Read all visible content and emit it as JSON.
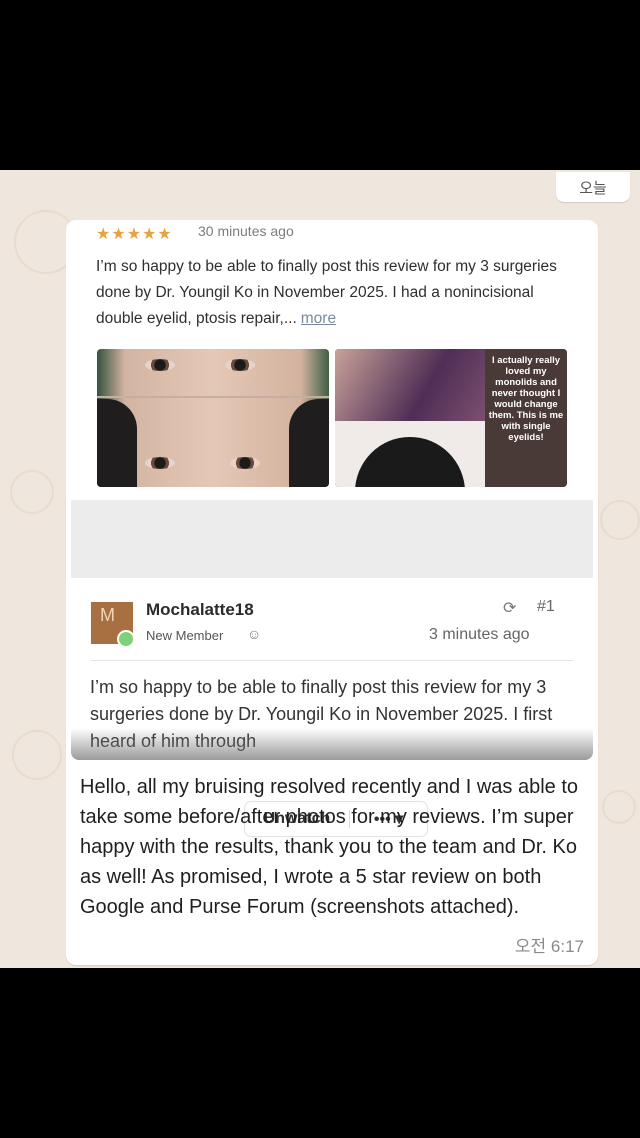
{
  "chat": {
    "date_chip": "오늘",
    "message_time": "오전 6:17",
    "message_text": "Hello, all my bruising resolved recently and I was able to take some before/after photos for my reviews. I’m super happy with the results, thank you to the team and Dr. Ko as well! As promised, I wrote a 5 star review on both Google and Purse Forum (screenshots attached)."
  },
  "review": {
    "stars": "★★★★★",
    "time": "30 minutes ago",
    "text": "I’m so happy to be able to finally post this review for my 3 surgeries done by Dr. Youngil Ko in November 2025. I had a nonincisional double eyelid, ptosis repair,...",
    "more_link": "more",
    "photo_overlay_text": "I actually really loved my monolids and never thought I would change them. This is me with single eyelids!"
  },
  "forum_post": {
    "unwatch_label": "Unwatch",
    "more_menu_label": "••• ▾",
    "avatar_letter": "M",
    "username": "Mochalatte18",
    "member_role": "New Member",
    "post_number": "#1",
    "post_time": "3 minutes ago",
    "body": "I’m so happy to be able to finally post this review for my 3 surgeries done by Dr. Youngil Ko in November 2025. I first heard of him through"
  },
  "icons": {
    "share": "share-icon",
    "member_badge": "member-edit-icon",
    "online": "online-status-icon"
  },
  "colors": {
    "star": "#e8a33d",
    "chat_background": "#efe7dd",
    "avatar": "#a87041",
    "online": "#7ed07a"
  }
}
